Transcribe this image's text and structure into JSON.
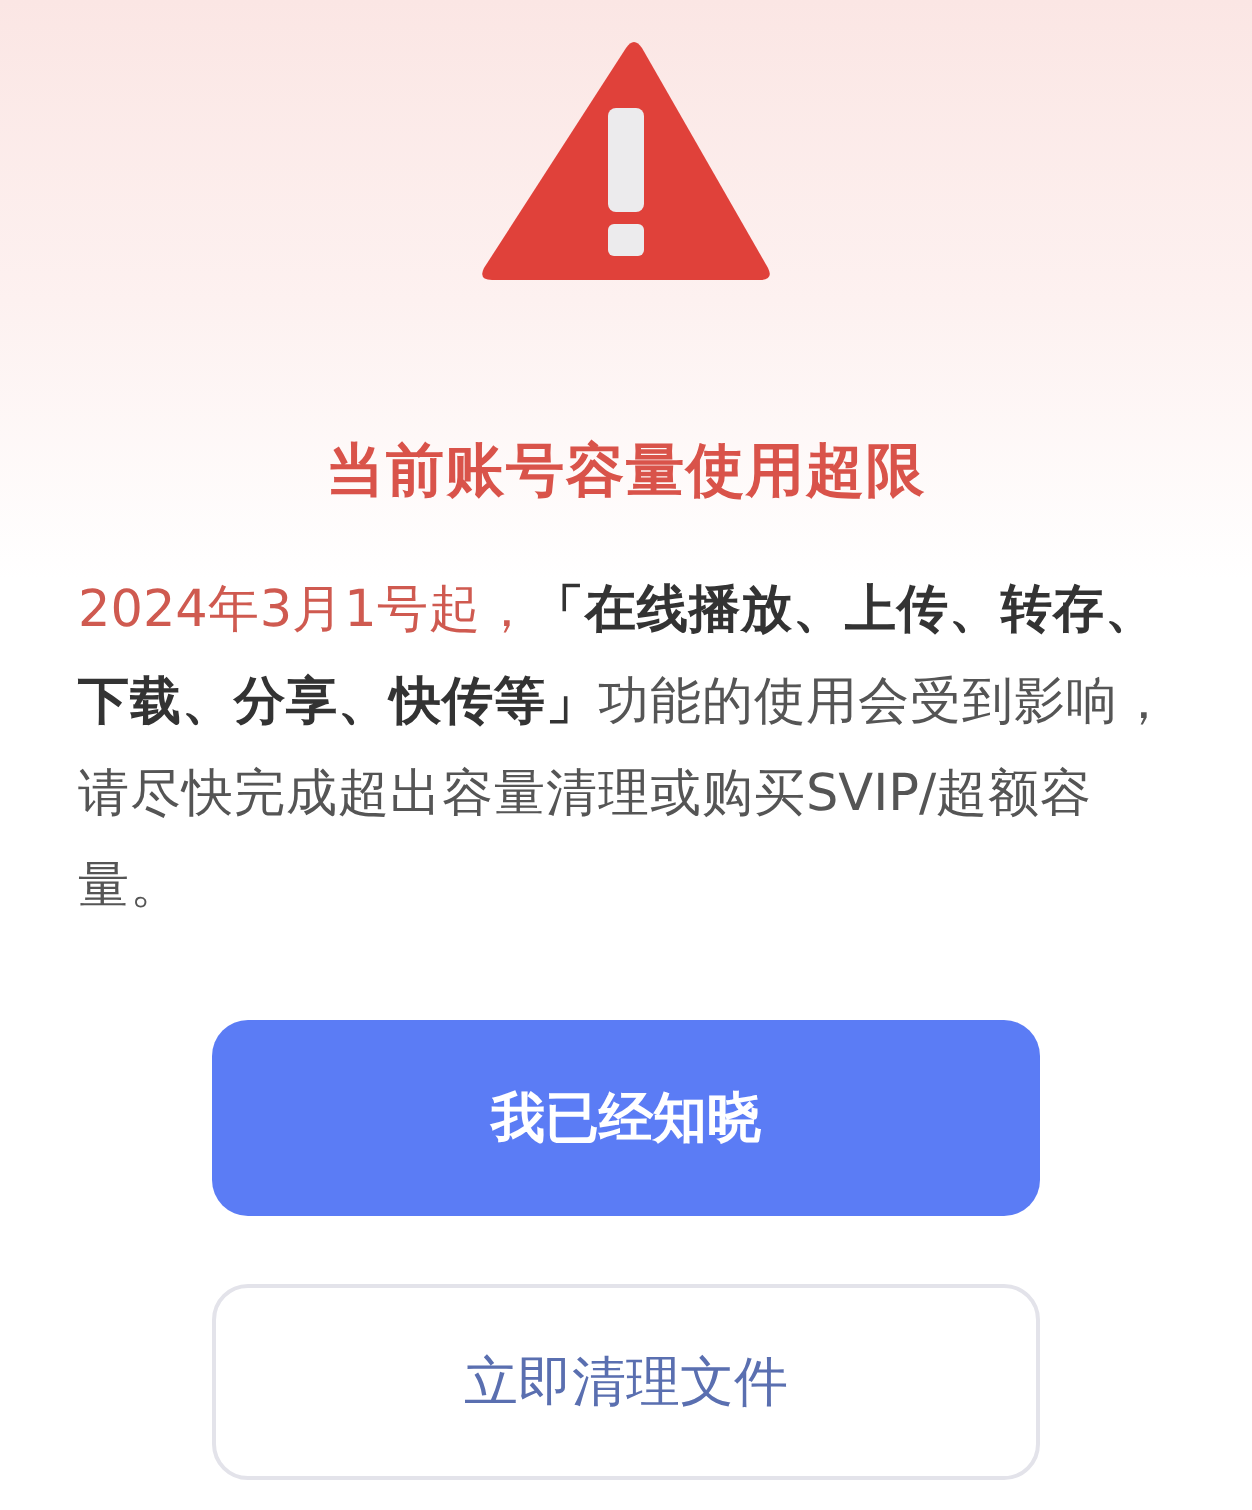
{
  "title": "当前账号容量使用超限",
  "message": [
    {
      "kind": "highlight",
      "text": "2024年3月1号起，"
    },
    {
      "kind": "bold",
      "text": "「在线播放、上传、转存、下载、分享、快传等」"
    },
    {
      "kind": "plain",
      "text": "功能的使用会受到影响，请尽快完成超出容量清理或购买SVIP/超额容量。"
    }
  ],
  "buttons": [
    {
      "kind": "primary",
      "label": "我已经知晓"
    },
    {
      "kind": "secondary",
      "label": "立即清理文件"
    }
  ]
}
